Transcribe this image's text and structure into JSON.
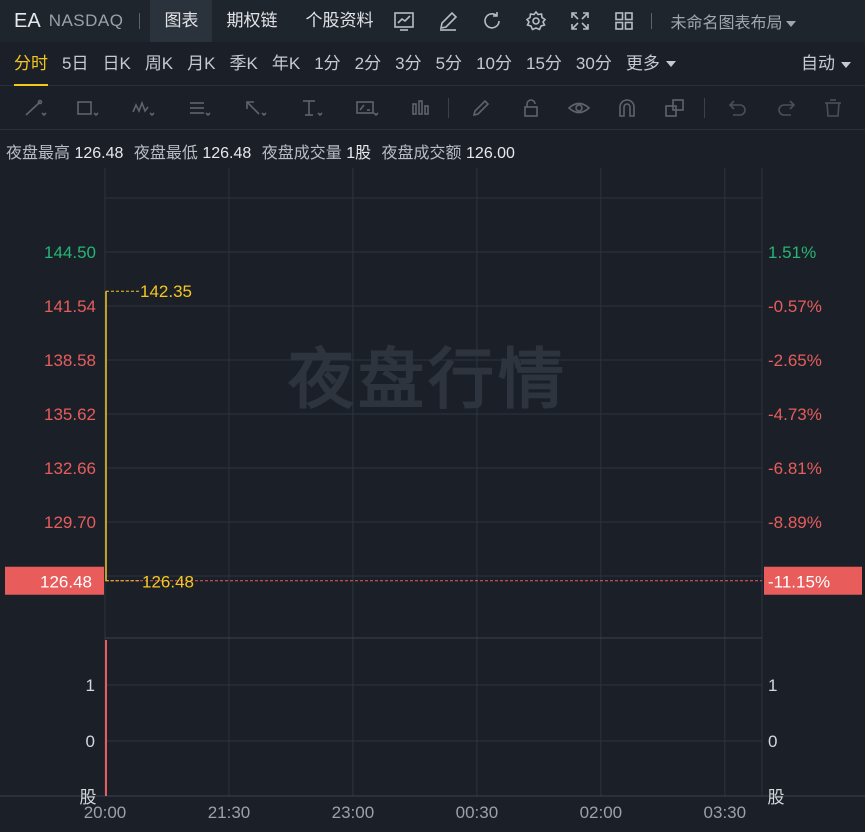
{
  "header": {
    "symbol": "EA",
    "exchange": "NASDAQ",
    "tabs": [
      "图表",
      "期权链",
      "个股资料"
    ],
    "active_tab": "图表",
    "layout_name": "未命名图表布局"
  },
  "periods": {
    "items": [
      "分时",
      "5日",
      "日K",
      "周K",
      "月K",
      "季K",
      "年K",
      "1分",
      "2分",
      "3分",
      "5分",
      "10分",
      "15分",
      "30分",
      "更多"
    ],
    "active": "分时",
    "mode": "自动"
  },
  "info": {
    "high_label": "夜盘最高",
    "high_value": "126.48",
    "low_label": "夜盘最低",
    "low_value": "126.48",
    "volume_label": "夜盘成交量",
    "volume_value": "1股",
    "turnover_label": "夜盘成交额",
    "turnover_value": "126.00"
  },
  "watermark": "夜盘行情",
  "colors": {
    "up": "#26b574",
    "down": "#e85c5c",
    "price_line": "#f5c61f",
    "accent": "#f5c61f",
    "grid": "#2c343e"
  },
  "chart_data": {
    "type": "line",
    "title": "",
    "x_ticks": [
      "20:00",
      "21:30",
      "23:00",
      "00:30",
      "02:00",
      "03:30"
    ],
    "y_ticks_price": [
      144.5,
      141.54,
      138.58,
      135.62,
      132.66,
      129.7,
      126.48
    ],
    "y_ticks_pct": [
      "1.51%",
      "-0.57%",
      "-2.65%",
      "-4.73%",
      "-6.81%",
      "-8.89%",
      "-11.15%"
    ],
    "last_price": "126.48",
    "last_pct": "-11.15%",
    "max_label": "142.35",
    "min_label": "126.48",
    "series": [
      {
        "x": [
          "20:00",
          "20:00"
        ],
        "values": [
          142.35,
          126.48
        ]
      }
    ],
    "volume": {
      "y_ticks": [
        "1",
        "0"
      ],
      "unit": "股",
      "values": [
        1
      ]
    }
  }
}
